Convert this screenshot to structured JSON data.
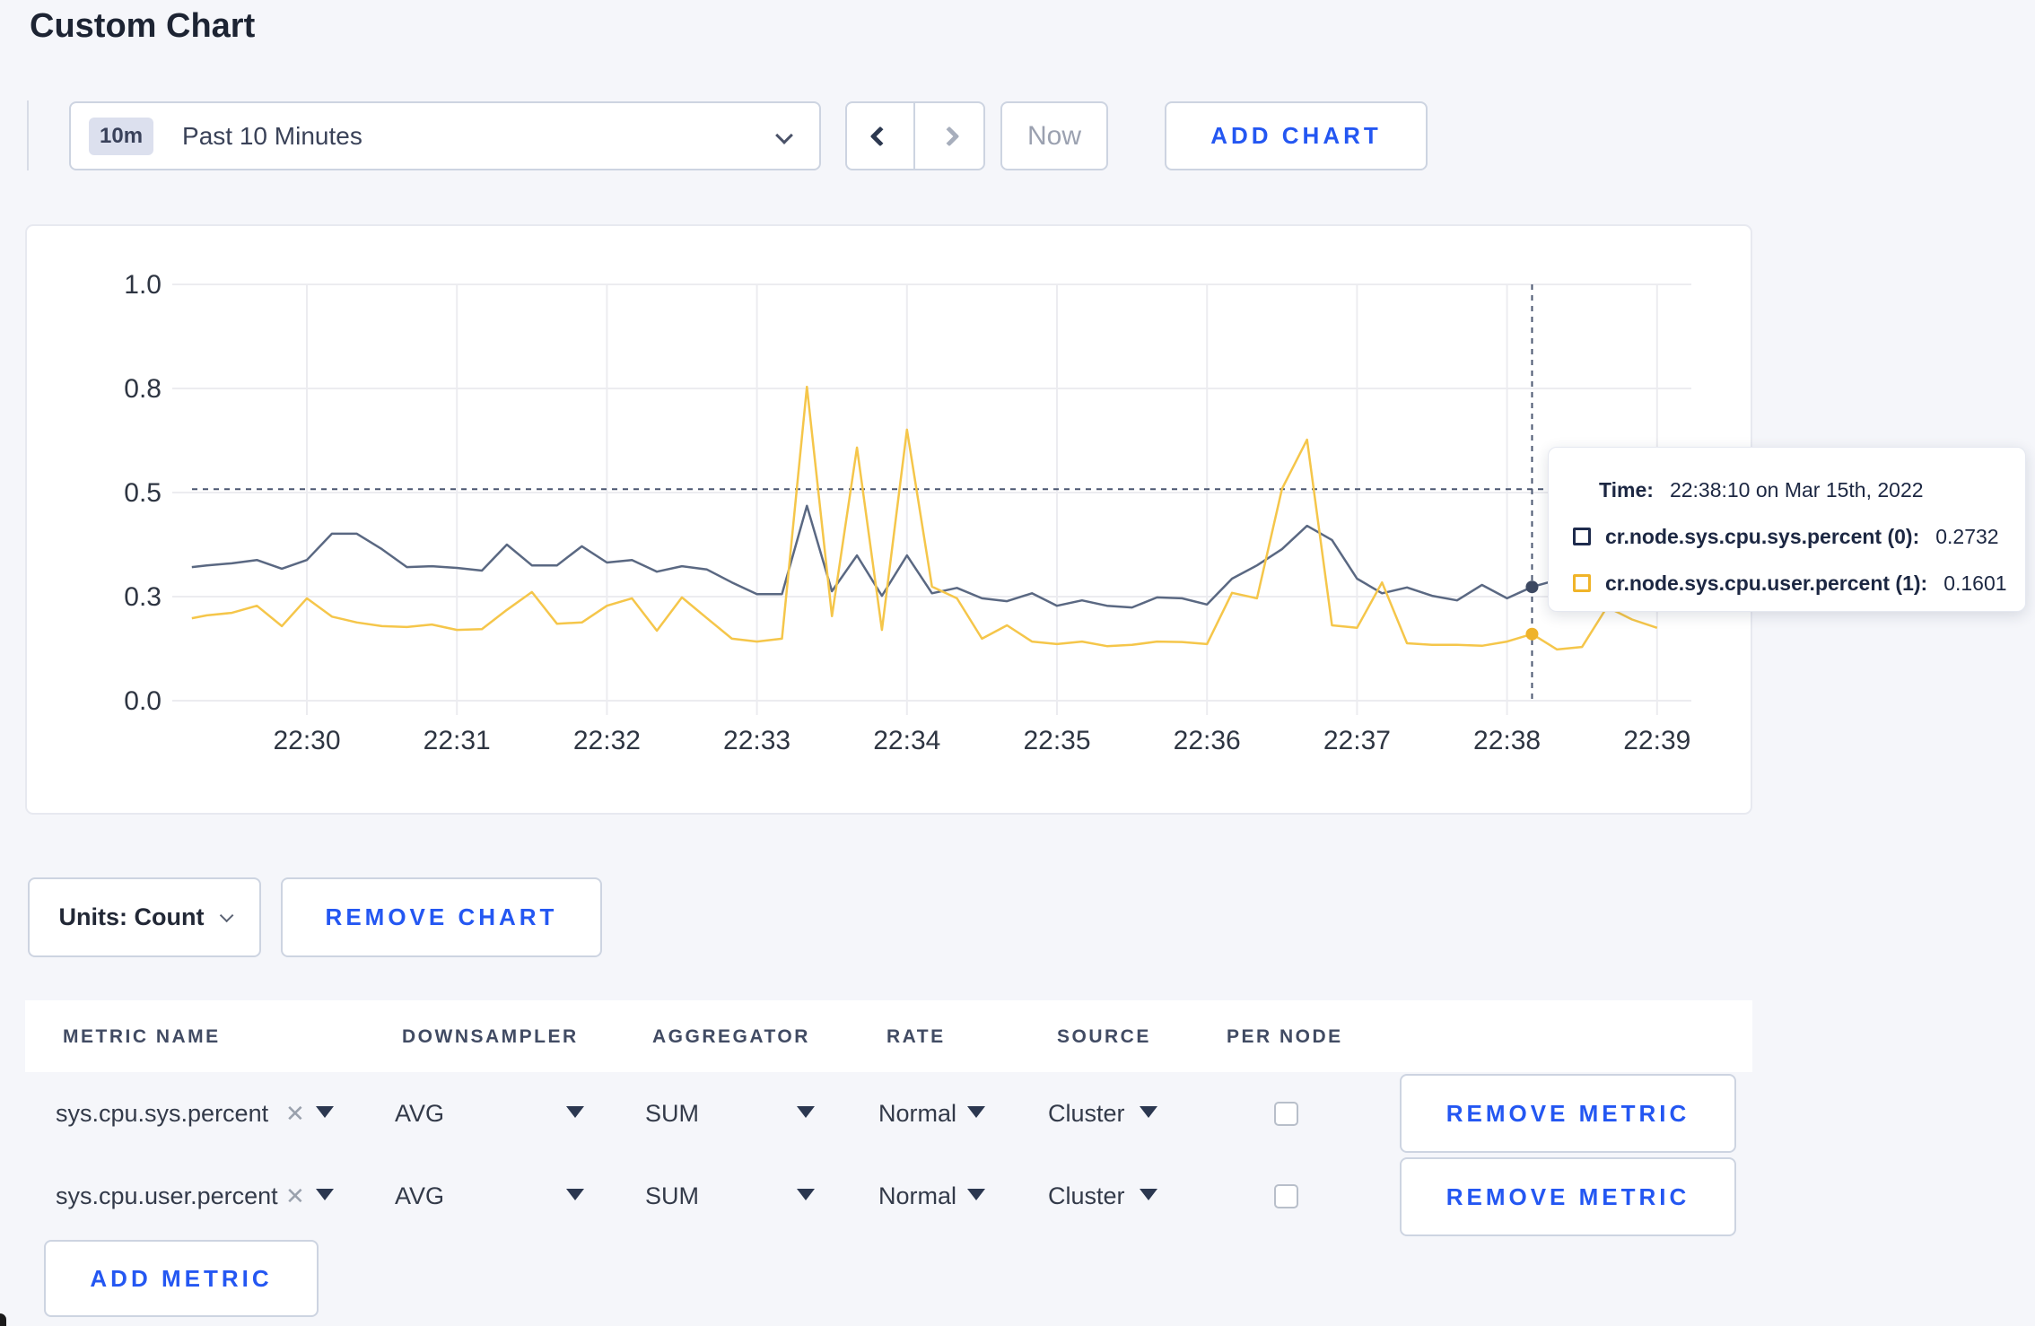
{
  "page": {
    "title": "Custom Chart"
  },
  "toolbar": {
    "time_range": {
      "badge": "10m",
      "label": "Past 10 Minutes"
    },
    "now_label": "Now",
    "add_chart_label": "ADD CHART"
  },
  "chart_data": {
    "type": "line",
    "x_tick_labels": [
      "22:30",
      "22:31",
      "22:32",
      "22:33",
      "22:34",
      "22:35",
      "22:36",
      "22:37",
      "22:38",
      "22:39"
    ],
    "y_tick_values": [
      0,
      0.25,
      0.5,
      0.75,
      1.0
    ],
    "y_tick_labels": [
      "0.0",
      "0.3",
      "0.5",
      "0.8",
      "1.0"
    ],
    "ylim": [
      0,
      1
    ],
    "x_seconds": [
      -46,
      -40,
      -30,
      -20,
      -10,
      0,
      10,
      20,
      30,
      40,
      50,
      60,
      70,
      80,
      90,
      100,
      110,
      120,
      130,
      140,
      150,
      160,
      170,
      180,
      190,
      200,
      210,
      220,
      230,
      240,
      250,
      260,
      270,
      280,
      290,
      300,
      310,
      320,
      330,
      340,
      350,
      360,
      370,
      380,
      390,
      400,
      410,
      420,
      430,
      440,
      450,
      460,
      470,
      480,
      490,
      500,
      510,
      520,
      530,
      540
    ],
    "series": [
      {
        "name": "cr.node.sys.cpu.sys.percent (0)",
        "color": "#5a6882",
        "values": [
          0.321,
          0.325,
          0.33,
          0.338,
          0.317,
          0.338,
          0.401,
          0.401,
          0.364,
          0.321,
          0.323,
          0.319,
          0.3125,
          0.375,
          0.325,
          0.325,
          0.371,
          0.332,
          0.338,
          0.31,
          0.323,
          0.315,
          0.284,
          0.256,
          0.256,
          0.468,
          0.263,
          0.349,
          0.252,
          0.349,
          0.258,
          0.271,
          0.246,
          0.239,
          0.258,
          0.228,
          0.241,
          0.228,
          0.224,
          0.248,
          0.246,
          0.231,
          0.293,
          0.325,
          0.364,
          0.42,
          0.386,
          0.293,
          0.258,
          0.272,
          0.252,
          0.241,
          0.278,
          0.246,
          0.2732,
          0.29,
          0.3,
          0.292,
          0.298,
          0.3
        ]
      },
      {
        "name": "cr.node.sys.cpu.user.percent (1)",
        "color": "#f5c64a",
        "values": [
          0.198,
          0.205,
          0.211,
          0.228,
          0.179,
          0.246,
          0.202,
          0.188,
          0.179,
          0.177,
          0.183,
          0.17,
          0.172,
          0.218,
          0.261,
          0.185,
          0.188,
          0.228,
          0.246,
          0.168,
          0.248,
          0.198,
          0.149,
          0.142,
          0.149,
          0.754,
          0.203,
          0.608,
          0.17,
          0.651,
          0.274,
          0.246,
          0.149,
          0.181,
          0.142,
          0.136,
          0.142,
          0.131,
          0.134,
          0.142,
          0.141,
          0.136,
          0.259,
          0.246,
          0.509,
          0.627,
          0.181,
          0.175,
          0.284,
          0.138,
          0.134,
          0.134,
          0.132,
          0.142,
          0.1601,
          0.123,
          0.129,
          0.225,
          0.195,
          0.175
        ]
      }
    ],
    "crosshair": {
      "x_seconds": 490,
      "hline_value": 0.508,
      "markers": [
        {
          "series": 0,
          "value": 0.2732,
          "color": "#3d4962"
        },
        {
          "series": 1,
          "value": 0.1601,
          "color": "#efb32a"
        }
      ]
    },
    "grid_color": "#ececf0",
    "axis_label_color": "#2e3542"
  },
  "tooltip": {
    "time_label": "Time:",
    "time_value": "22:38:10 on Mar 15th, 2022",
    "entries": [
      {
        "label": "cr.node.sys.cpu.sys.percent (0):",
        "value": "0.2732",
        "color": "#1e2b4d"
      },
      {
        "label": "cr.node.sys.cpu.user.percent (1):",
        "value": "0.1601",
        "color": "#f0b429"
      }
    ]
  },
  "chart_controls": {
    "units_label": "Units: Count",
    "remove_chart_label": "REMOVE CHART"
  },
  "metrics_table": {
    "headers": [
      "METRIC NAME",
      "DOWNSAMPLER",
      "AGGREGATOR",
      "RATE",
      "SOURCE",
      "PER NODE"
    ],
    "rows": [
      {
        "metric": "sys.cpu.sys.percent",
        "downsampler": "AVG",
        "aggregator": "SUM",
        "rate": "Normal",
        "source": "Cluster",
        "per_node_checked": false,
        "remove_label": "REMOVE METRIC"
      },
      {
        "metric": "sys.cpu.user.percent",
        "downsampler": "AVG",
        "aggregator": "SUM",
        "rate": "Normal",
        "source": "Cluster",
        "per_node_checked": false,
        "remove_label": "REMOVE METRIC"
      }
    ],
    "add_metric_label": "ADD METRIC"
  }
}
